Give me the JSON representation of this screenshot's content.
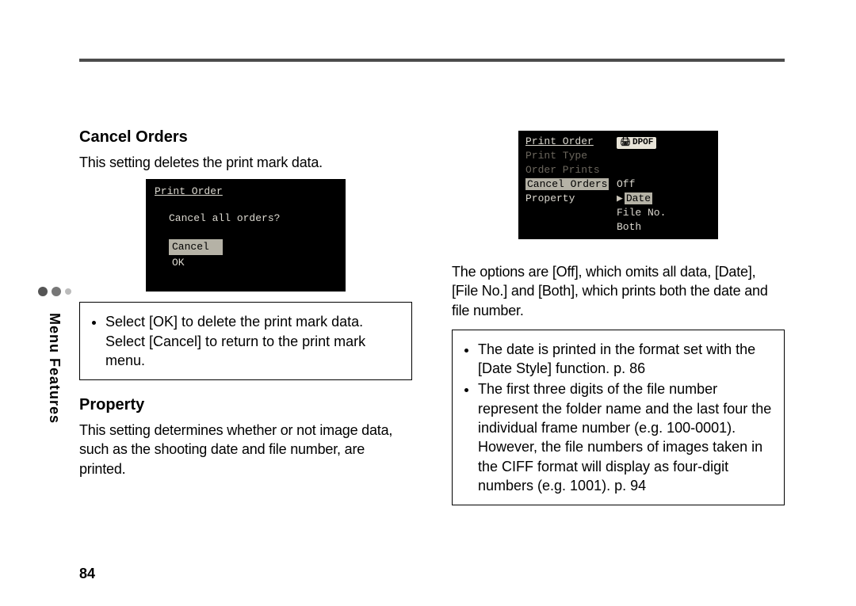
{
  "sidebar_label": "Menu Features",
  "page_number": "84",
  "left": {
    "section1": {
      "title": "Cancel Orders",
      "body": "This setting deletes the print mark data.",
      "note": "Select [OK] to delete the print mark data. Select [Cancel] to return to the print mark menu."
    },
    "section2": {
      "title": "Property",
      "body": "This setting determines whether or not image data, such as the shooting date and file number, are printed."
    },
    "lcd1": {
      "title": "Print Order",
      "question": "Cancel all orders?",
      "opt_cancel": "Cancel",
      "opt_ok": "OK"
    }
  },
  "right": {
    "body": "The options are [Off], which omits all data, [Date], [File No.] and [Both], which prints both the date and file number.",
    "notes": [
      "The date is printed in the format set with the [Date Style] function. p. 86",
      "The first three digits of the file number represent the folder name and the last four the individual frame number (e.g. 100-0001). However, the file numbers of images taken in the CIFF format will display as four-digit numbers (e.g. 1001). p. 94"
    ],
    "lcd2": {
      "items_left": [
        "Print Order",
        "Print Type",
        "Order Prints",
        "Cancel Orders",
        "Property"
      ],
      "badge": "DPOF",
      "options_right": [
        "Off",
        "Date",
        "File No.",
        "Both"
      ]
    }
  }
}
